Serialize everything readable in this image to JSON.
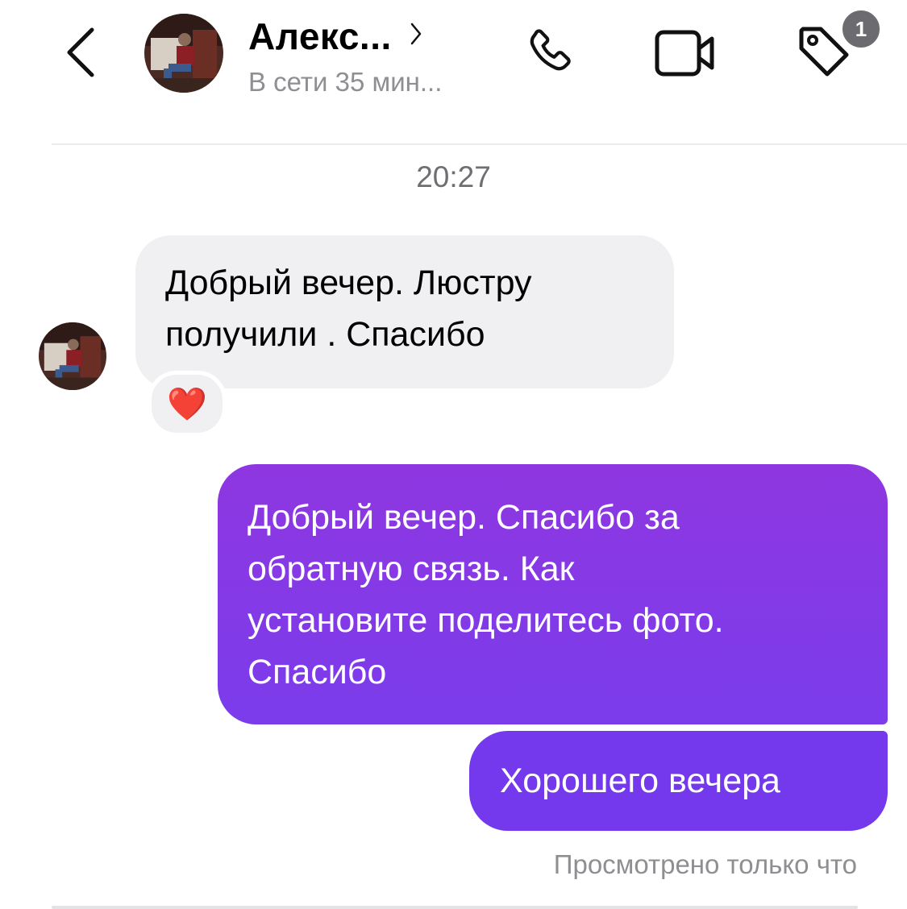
{
  "header": {
    "contact_name": "Алекс...",
    "status": "В сети 35 мин...",
    "badge_count": "1",
    "icons": [
      "back-chevron-icon",
      "phone-icon",
      "video-camera-icon",
      "tag-icon",
      "chevron-right-icon"
    ]
  },
  "chat": {
    "timestamp": "20:27",
    "messages": [
      {
        "direction": "incoming",
        "text": "Добрый вечер. Люстру\nполучили . Спасибо",
        "reaction": "❤️"
      },
      {
        "direction": "outgoing",
        "text": "Добрый вечер. Спасибо за\nобратную связь. Как\nустановите поделитесь фото.\nСпасибо"
      },
      {
        "direction": "outgoing",
        "text": "Хорошего вечера"
      }
    ],
    "seen_status": "Просмотрено только что"
  },
  "colors": {
    "outgoing_bubble_top": "#8e37e0",
    "outgoing_bubble_bottom": "#7439ec",
    "incoming_bubble": "#f0f0f2",
    "badge": "#6b6b70",
    "secondary_text": "#8e8e93"
  }
}
